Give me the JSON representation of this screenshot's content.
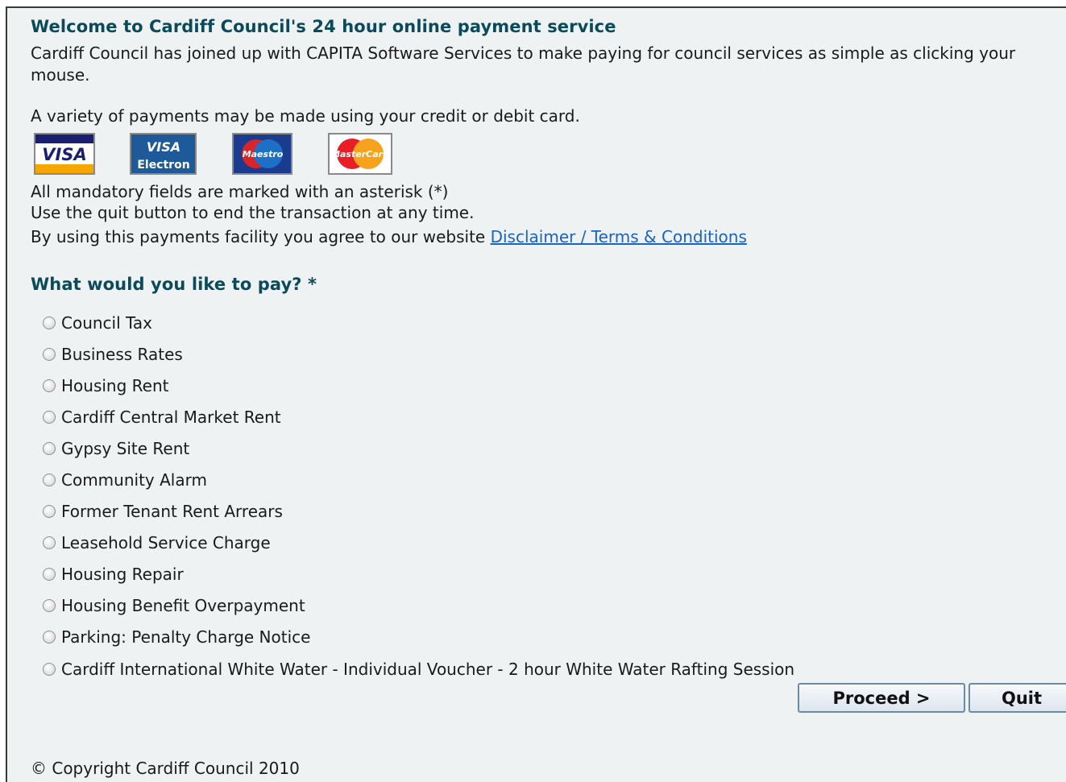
{
  "page": {
    "title": "Welcome to Cardiff Council's 24 hour online payment service",
    "intro": "Cardiff Council has joined up with CAPITA Software Services to make paying for council services as simple as clicking your mouse.",
    "cards_text": "A variety of payments may be made using your credit or debit card.",
    "cards": [
      {
        "name": "VISA",
        "icon": "visa-card-icon"
      },
      {
        "name": "VISA Electron",
        "icon": "visa-electron-card-icon"
      },
      {
        "name": "Maestro",
        "icon": "maestro-card-icon"
      },
      {
        "name": "MasterCard",
        "icon": "mastercard-card-icon"
      }
    ],
    "mandatory_note": "All mandatory fields are marked with an asterisk (*)",
    "quit_note": "Use the quit button to end the transaction at any time.",
    "agree_prefix": "By using this payments facility you agree to our website",
    "disclaimer_link": "Disclaimer / Terms & Conditions"
  },
  "question": {
    "label": "What would you like to pay? *",
    "options": [
      "Council Tax",
      "Business Rates",
      "Housing Rent",
      "Cardiff Central Market Rent",
      "Gypsy Site Rent",
      "Community Alarm",
      "Former Tenant Rent Arrears",
      "Leasehold Service Charge",
      "Housing Repair",
      "Housing Benefit Overpayment",
      "Parking: Penalty Charge Notice",
      "Cardiff International White Water - Individual Voucher - 2 hour White Water Rafting Session"
    ]
  },
  "buttons": {
    "proceed": "Proceed >",
    "quit": "Quit"
  },
  "footer": {
    "copyright": "© Copyright Cardiff Council 2010"
  },
  "colors": {
    "heading": "#0b4a5a",
    "link": "#1a63c8",
    "panel_bg": "#eef2f2"
  }
}
